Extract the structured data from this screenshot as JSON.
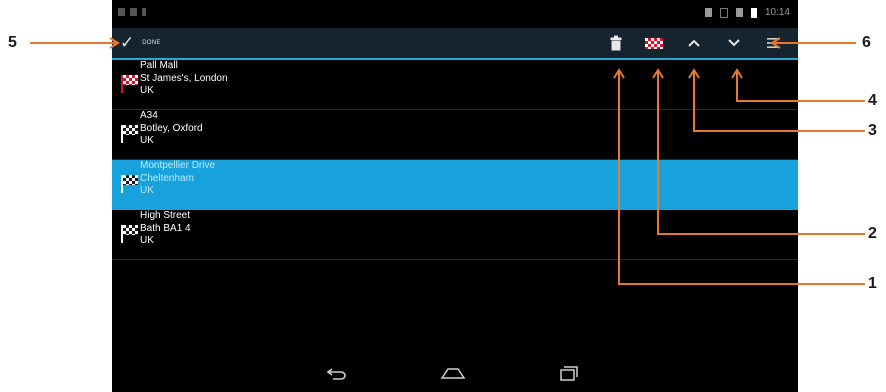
{
  "status_bar": {
    "time": "10:14"
  },
  "action_bar": {
    "done_label": "DONE",
    "icons": [
      "checkmark-icon",
      "trash-icon",
      "checkered-flag-icon",
      "chevron-up-icon",
      "chevron-down-icon",
      "menu-icon"
    ]
  },
  "waypoints": [
    {
      "line1": "Pall Mall",
      "line2": "St James's, London",
      "line3": "UK",
      "flag": "red",
      "selected": false
    },
    {
      "line1": "A34",
      "line2": "Botley, Oxford",
      "line3": "UK",
      "flag": "black-white",
      "selected": false
    },
    {
      "line1": "Montpellier Drive",
      "line2": "Cheltenham",
      "line3": "UK",
      "flag": "black-white",
      "selected": true
    },
    {
      "line1": "High Street",
      "line2": "Bath BA1 4",
      "line3": "UK",
      "flag": "black-white",
      "selected": false
    }
  ],
  "nav_bar": {
    "icons": [
      "back-icon",
      "home-icon",
      "recents-icon"
    ]
  },
  "callouts": {
    "c1": "1",
    "c2": "2",
    "c3": "3",
    "c4": "4",
    "c5": "5",
    "c6": "6"
  },
  "colors": {
    "accent": "#29a8d8",
    "selected_row": "#17a2dc",
    "action_bar": "#15242e",
    "callout_orange": "#e8792b",
    "flag_red": "#d8102a"
  }
}
